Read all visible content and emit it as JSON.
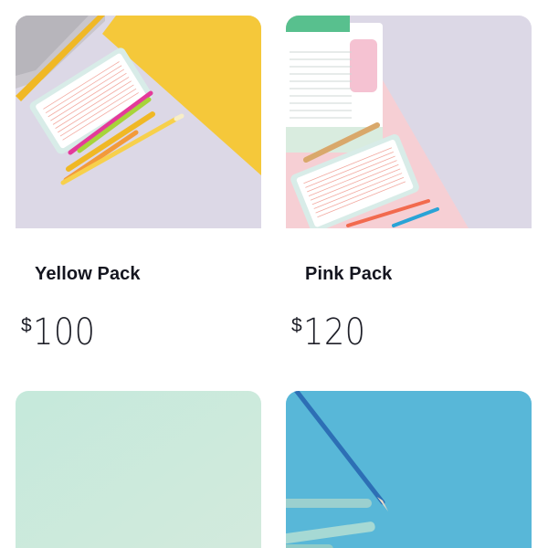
{
  "products": [
    {
      "name": "Yellow Pack",
      "currency": "$",
      "price": "100"
    },
    {
      "name": "Pink Pack",
      "currency": "$",
      "price": "120"
    },
    {
      "name": "",
      "currency": "",
      "price": ""
    },
    {
      "name": "",
      "currency": "",
      "price": ""
    }
  ],
  "colors": {
    "yellow": "#f5c83a",
    "lavender": "#dcd8e6",
    "pink": "#f6cfd4",
    "mint": "#c7e9dc",
    "sky": "#58b7d8",
    "text": "#14151f"
  },
  "icons": [
    "stationery-photo-yellow",
    "stationery-photo-pink",
    "mint-photo",
    "blue-pencil-photo"
  ]
}
